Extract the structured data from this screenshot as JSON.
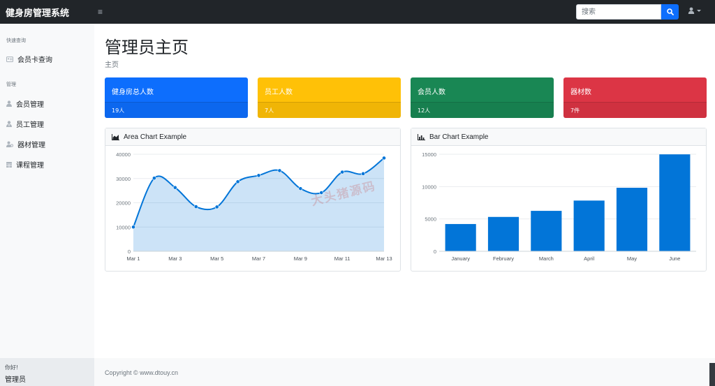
{
  "navbar": {
    "brand": "健身房管理系统",
    "toggle_icon": "≡",
    "search_placeholder": "搜索"
  },
  "sidebar": {
    "heading_quick": "快速查询",
    "quick_items": [
      {
        "label": "会员卡查询",
        "icon": "address-card-icon"
      }
    ],
    "heading_manage": "管理",
    "manage_items": [
      {
        "label": "会员管理",
        "icon": "user-icon"
      },
      {
        "label": "员工管理",
        "icon": "user-tie-icon"
      },
      {
        "label": "器材管理",
        "icon": "users-cog-icon"
      },
      {
        "label": "课程管理",
        "icon": "table-icon"
      }
    ],
    "footer_greeting": "你好!",
    "footer_user": "管理员"
  },
  "main": {
    "title": "管理员主页",
    "breadcrumb": "主页",
    "cards": [
      {
        "title": "健身房总人数",
        "value": "19人",
        "color": "#0d6efd"
      },
      {
        "title": "员工人数",
        "value": "7人",
        "color": "#ffc107"
      },
      {
        "title": "会员人数",
        "value": "12人",
        "color": "#198754"
      },
      {
        "title": "器材数",
        "value": "7件",
        "color": "#dc3545"
      }
    ],
    "area_chart_title": "Area Chart Example",
    "bar_chart_title": "Bar Chart Example"
  },
  "watermark": "大头猪源码",
  "footer": {
    "copyright": "Copyright © www.dtouy.cn"
  },
  "chart_data": [
    {
      "type": "area",
      "title": "Area Chart Example",
      "x": [
        "Mar 1",
        "Mar 2",
        "Mar 3",
        "Mar 4",
        "Mar 5",
        "Mar 6",
        "Mar 7",
        "Mar 8",
        "Mar 9",
        "Mar 10",
        "Mar 11",
        "Mar 12",
        "Mar 13"
      ],
      "x_tick_labels": [
        "Mar 1",
        "Mar 3",
        "Mar 5",
        "Mar 7",
        "Mar 9",
        "Mar 11",
        "Mar 13"
      ],
      "values": [
        10000,
        30162,
        26263,
        18394,
        18287,
        28682,
        31274,
        33259,
        25849,
        24159,
        32651,
        31984,
        38451
      ],
      "ylim": [
        0,
        40000
      ],
      "y_ticks": [
        0,
        10000,
        20000,
        30000,
        40000
      ],
      "line_color": "#0275d8",
      "fill_color": "rgba(2,117,216,0.2)",
      "grid": true
    },
    {
      "type": "bar",
      "title": "Bar Chart Example",
      "categories": [
        "January",
        "February",
        "March",
        "April",
        "May",
        "June"
      ],
      "values": [
        4215,
        5312,
        6251,
        7841,
        9821,
        14984
      ],
      "ylim": [
        0,
        15000
      ],
      "y_ticks": [
        0,
        5000,
        10000,
        15000
      ],
      "bar_color": "#0275d8",
      "grid": true
    }
  ]
}
